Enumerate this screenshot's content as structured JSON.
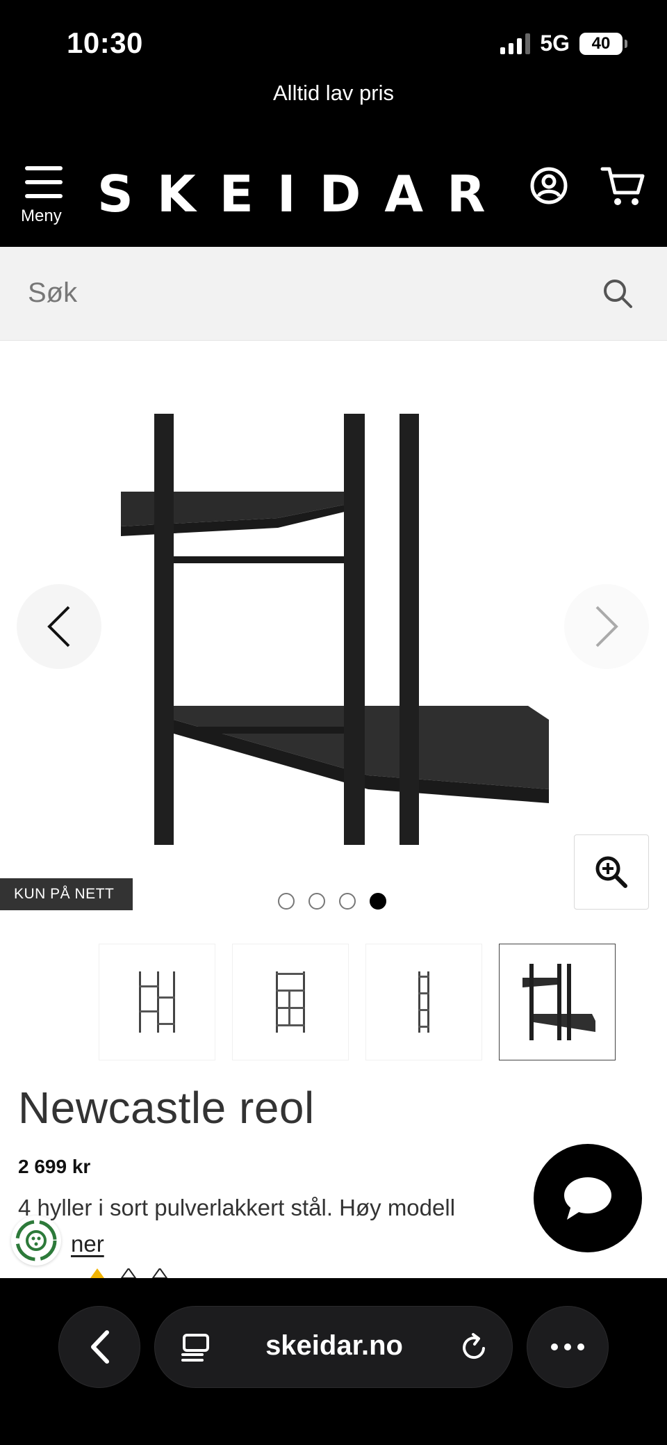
{
  "status_bar": {
    "time": "10:30",
    "network": "5G",
    "battery": "40"
  },
  "promo": {
    "text": "Alltid lav pris"
  },
  "header": {
    "menu_label": "Meny",
    "logo": "SKEIDAR",
    "account_icon": "user-circle-icon",
    "cart_icon": "shopping-cart-icon"
  },
  "search": {
    "placeholder": "Søk",
    "icon": "search-icon"
  },
  "gallery": {
    "badge": "KUN PÅ NETT",
    "image_count": 4,
    "active_index": 3,
    "zoom_icon": "zoom-in-icon",
    "prev_icon": "chevron-left-icon",
    "next_icon": "chevron-right-icon"
  },
  "product": {
    "title": "Newcastle reol",
    "price": "2 699 kr",
    "description": "4 hyller i sort pulverlakkert stål. Høy modell",
    "read_more": "ner"
  },
  "browser": {
    "url": "skeidar.no",
    "back_icon": "chevron-left-icon",
    "tabs_icon": "tabs-icon",
    "reload_icon": "reload-icon",
    "more_icon": "more-icon"
  },
  "colors": {
    "header_bg": "#000000",
    "search_bg": "#f2f2f2",
    "badge_bg": "#333333",
    "text": "#333333"
  }
}
